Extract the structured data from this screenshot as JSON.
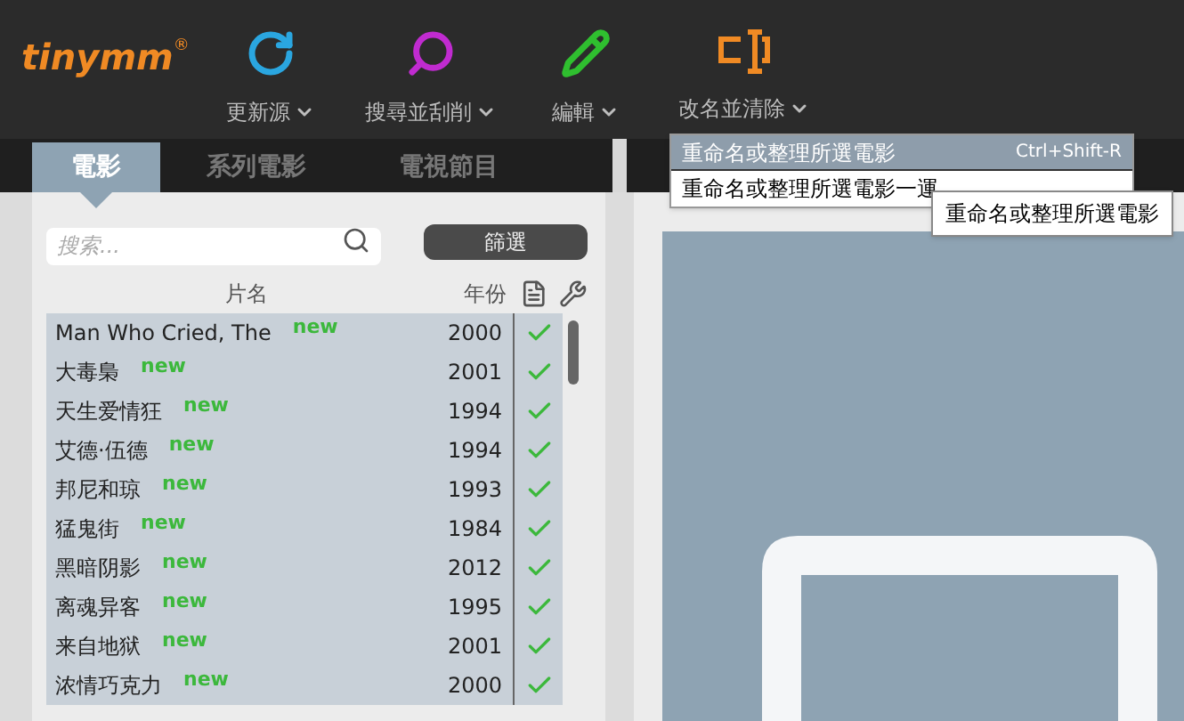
{
  "logo": {
    "text": "tinymm",
    "mark": "®"
  },
  "toolbar": [
    {
      "kind": "refresh",
      "label": "更新源"
    },
    {
      "kind": "search",
      "label": "搜尋並刮削"
    },
    {
      "kind": "edit",
      "label": "編輯"
    },
    {
      "kind": "rename",
      "label": "改名並清除"
    }
  ],
  "tabs": [
    {
      "label": "電影",
      "selected": true
    },
    {
      "label": "系列電影",
      "selected": false
    },
    {
      "label": "電視節目",
      "selected": false
    }
  ],
  "search": {
    "placeholder": "搜索..."
  },
  "filter_button": "篩選",
  "columns": [
    "片名",
    "年份"
  ],
  "rows": [
    {
      "title": "Man Who Cried, The",
      "badge": "new",
      "year": "2000",
      "checked": true
    },
    {
      "title": "大毒梟",
      "badge": "new",
      "year": "2001",
      "checked": true
    },
    {
      "title": "天生爱情狂",
      "badge": "new",
      "year": "1994",
      "checked": true
    },
    {
      "title": "艾德·伍德",
      "badge": "new",
      "year": "1994",
      "checked": true
    },
    {
      "title": "邦尼和琼",
      "badge": "new",
      "year": "1993",
      "checked": true
    },
    {
      "title": "猛鬼街",
      "badge": "new",
      "year": "1984",
      "checked": true
    },
    {
      "title": "黑暗阴影",
      "badge": "new",
      "year": "2012",
      "checked": true
    },
    {
      "title": "离魂异客",
      "badge": "new",
      "year": "1995",
      "checked": true
    },
    {
      "title": "来自地狱",
      "badge": "new",
      "year": "2001",
      "checked": true
    },
    {
      "title": "浓情巧克力",
      "badge": "new",
      "year": "2000",
      "checked": true
    }
  ],
  "menu": [
    {
      "label": "重命名或整理所選電影",
      "shortcut": "Ctrl+Shift-R",
      "selected": true
    },
    {
      "label": "重命名或整理所選電影一運",
      "selected": false
    }
  ],
  "tooltip": "重命名或整理所選電影"
}
